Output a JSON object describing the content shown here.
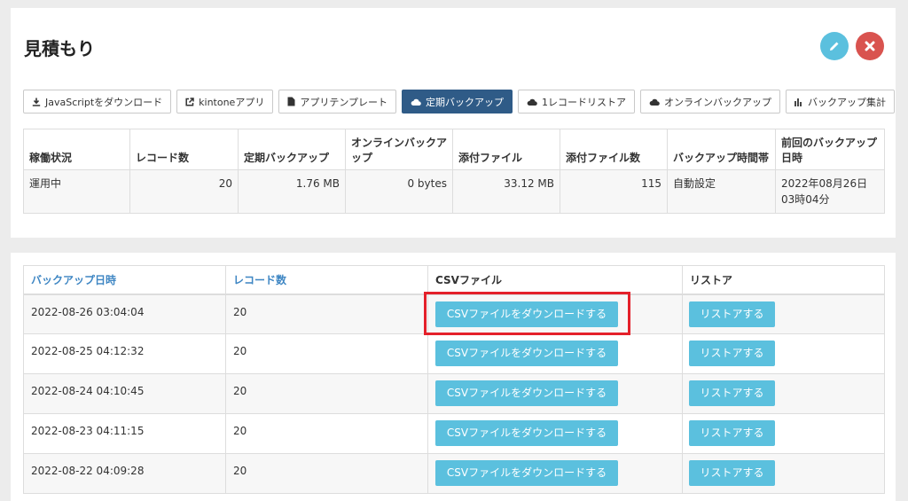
{
  "page": {
    "title": "見積もり"
  },
  "header": {
    "edit_icon": "pencil-icon",
    "close_icon": "close-icon"
  },
  "tabs": [
    {
      "label": "JavaScriptをダウンロード",
      "icon": "download-icon",
      "active": false
    },
    {
      "label": "kintoneアプリ",
      "icon": "external-link-icon",
      "active": false
    },
    {
      "label": "アプリテンプレート",
      "icon": "file-icon",
      "active": false
    },
    {
      "label": "定期バックアップ",
      "icon": "cloud-icon",
      "active": true
    },
    {
      "label": "1レコードリストア",
      "icon": "cloud-icon",
      "active": false
    },
    {
      "label": "オンラインバックアップ",
      "icon": "cloud-icon",
      "active": false
    },
    {
      "label": "バックアップ集計",
      "icon": "bar-chart-icon",
      "active": false
    }
  ],
  "stats": {
    "headers": [
      "稼働状況",
      "レコード数",
      "定期バックアップ",
      "オンラインバックアップ",
      "添付ファイル",
      "添付ファイル数",
      "バックアップ時間帯",
      "前回のバックアップ日時"
    ],
    "values": [
      "運用中",
      "20",
      "1.76 MB",
      "0 bytes",
      "33.12 MB",
      "115",
      "自動設定",
      "2022年08月26日03時04分"
    ]
  },
  "backups": {
    "headers": [
      "バックアップ日時",
      "レコード数",
      "CSVファイル",
      "リストア"
    ],
    "rows": [
      {
        "datetime": "2022-08-26 03:04:04",
        "records": "20",
        "csv_label": "CSVファイルをダウンロードする",
        "restore_label": "リストアする"
      },
      {
        "datetime": "2022-08-25 04:12:32",
        "records": "20",
        "csv_label": "CSVファイルをダウンロードする",
        "restore_label": "リストアする"
      },
      {
        "datetime": "2022-08-24 04:10:45",
        "records": "20",
        "csv_label": "CSVファイルをダウンロードする",
        "restore_label": "リストアする"
      },
      {
        "datetime": "2022-08-23 04:11:15",
        "records": "20",
        "csv_label": "CSVファイルをダウンロードする",
        "restore_label": "リストアする"
      },
      {
        "datetime": "2022-08-22 04:09:28",
        "records": "20",
        "csv_label": "CSVファイルをダウンロードする",
        "restore_label": "リストアする"
      }
    ]
  },
  "colors": {
    "accent": "#5bc0de",
    "active_tab": "#2f5b87",
    "danger": "#d9534f",
    "link": "#3e86c3",
    "highlight": "#e4202a"
  }
}
